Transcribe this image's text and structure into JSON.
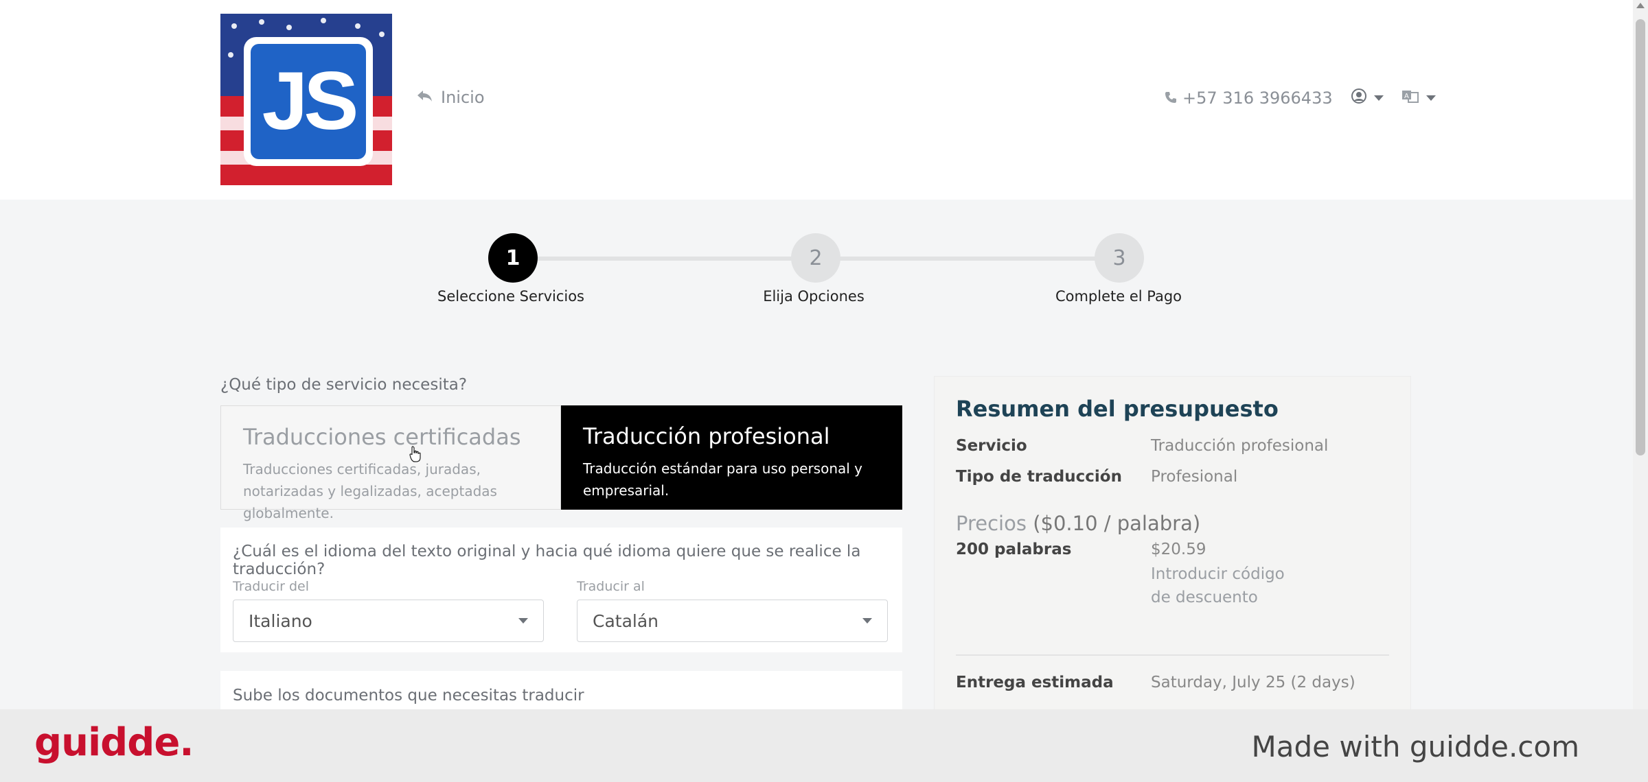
{
  "header": {
    "logo_text": "JS",
    "home_label": "Inicio",
    "phone": "+57 316 3966433"
  },
  "stepper": {
    "steps": [
      {
        "number": "1",
        "label": "Seleccione Servicios"
      },
      {
        "number": "2",
        "label": "Elija Opciones"
      },
      {
        "number": "3",
        "label": "Complete el Pago"
      }
    ]
  },
  "service": {
    "question": "¿Qué tipo de servicio necesita?",
    "options": [
      {
        "title": "Traducciones certificadas",
        "desc": "Traducciones certificadas, juradas, notarizadas y legalizadas, aceptadas globalmente."
      },
      {
        "title": "Traducción profesional",
        "desc": "Traducción estándar para uso personal y empresarial."
      }
    ],
    "selected": "Traducción profesional"
  },
  "languages": {
    "question": "¿Cuál es el idioma del texto original y hacia qué idioma quiere que se realice la traducción?",
    "from_label": "Traducir del",
    "from_value": "Italiano",
    "to_label": "Traducir al",
    "to_value": "Catalán"
  },
  "upload": {
    "question": "Sube los documentos que necesitas traducir"
  },
  "summary": {
    "title": "Resumen del presupuesto",
    "service_label": "Servicio",
    "service_value": "Traducción profesional",
    "type_label": "Tipo de traducción",
    "type_value": "Profesional",
    "prices_label": "Precios",
    "rate": "($0.10 / palabra)",
    "words_label": "200 palabras",
    "words_price": "$20.59",
    "discount_link": "Introducir código de descuento",
    "delivery_label": "Entrega estimada",
    "delivery_value": "Saturday, July 25 (2 days)"
  },
  "watermark": {
    "logo": "guidde.",
    "tagline": "Made with guidde.com"
  },
  "colors": {
    "brand_red": "#c8102e",
    "active_step": "#000000",
    "summary_title": "#1e4356"
  }
}
